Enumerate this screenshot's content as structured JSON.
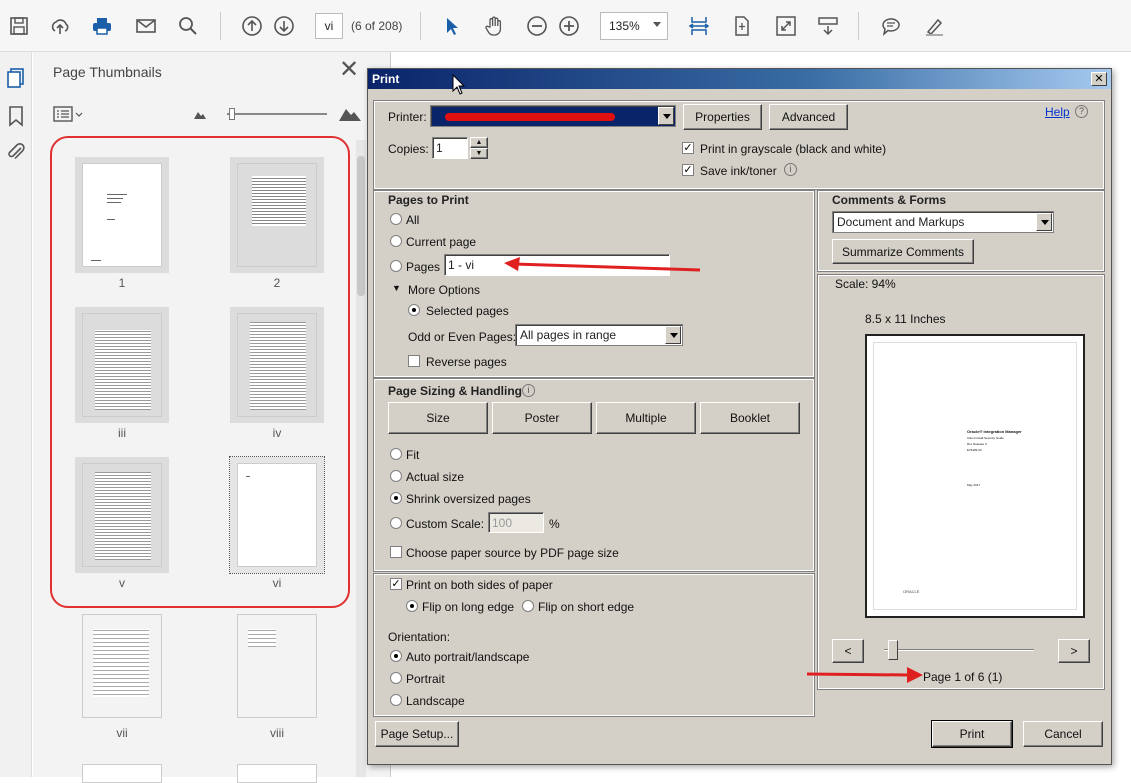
{
  "toolbar": {
    "page_value": "vi",
    "page_of": "(6 of 208)",
    "zoom": "135%"
  },
  "thumbs": {
    "title": "Page Thumbnails",
    "pages": [
      "1",
      "2",
      "iii",
      "iv",
      "v",
      "vi",
      "vii",
      "viii"
    ]
  },
  "dialog": {
    "title": "Print",
    "printer_label": "Printer:",
    "properties": "Properties",
    "advanced": "Advanced",
    "help": "Help",
    "copies_label": "Copies:",
    "copies_value": "1",
    "grayscale": "Print in grayscale (black and white)",
    "save_ink": "Save ink/toner",
    "pages_to_print": {
      "title": "Pages to Print",
      "all": "All",
      "current": "Current page",
      "pages": "Pages",
      "pages_value": "1 - vi",
      "more_options": "More Options",
      "selected_pages": "Selected pages",
      "odd_even_label": "Odd or Even Pages:",
      "odd_even_value": "All pages in range",
      "reverse": "Reverse pages"
    },
    "sizing": {
      "title": "Page Sizing & Handling",
      "size": "Size",
      "poster": "Poster",
      "multiple": "Multiple",
      "booklet": "Booklet",
      "fit": "Fit",
      "actual": "Actual size",
      "shrink": "Shrink oversized pages",
      "custom": "Custom Scale:",
      "custom_value": "100",
      "percent": "%",
      "paper_source": "Choose paper source by PDF page size"
    },
    "duplex": {
      "both_sides": "Print on both sides of paper",
      "long_edge": "Flip on long edge",
      "short_edge": "Flip on short edge",
      "orientation": "Orientation:",
      "auto": "Auto portrait/landscape",
      "portrait": "Portrait",
      "landscape": "Landscape"
    },
    "comments": {
      "title": "Comments & Forms",
      "value": "Document and Markups",
      "summarize": "Summarize Comments"
    },
    "preview": {
      "scale": "Scale:  94%",
      "paper": "8.5 x 11 Inches",
      "prev": "<",
      "next": ">",
      "page_info": "Page 1 of 6 (1)",
      "doc_line1": "Oracle® Integration Manager",
      "doc_line2": "Client Install Security Guide",
      "doc_line3": "Rel. Release X",
      "doc_line4": "E76483-03",
      "doc_date": "May 2017",
      "doc_logo": "ORACLE"
    },
    "page_setup": "Page Setup...",
    "print": "Print",
    "cancel": "Cancel"
  }
}
